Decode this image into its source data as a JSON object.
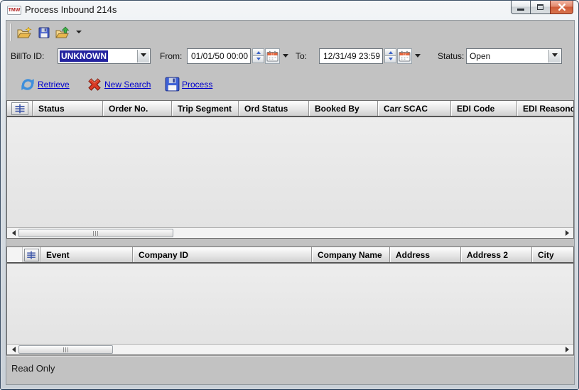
{
  "window": {
    "title": "Process Inbound 214s",
    "app_icon_text": "TMW",
    "status_text": "Read Only"
  },
  "toolbar": {
    "icons": [
      "new-folder-icon",
      "save-icon",
      "export-folder-icon",
      "toolbar-overflow-arrow"
    ]
  },
  "filters": {
    "billto_label": "BillTo ID:",
    "billto_value": "UNKNOWN",
    "from_label": "From:",
    "from_value": "01/01/50 00:00",
    "to_label": "To:",
    "to_value": "12/31/49 23:59",
    "status_label": "Status:",
    "status_value": "Open"
  },
  "actions": {
    "retrieve": "Retrieve",
    "new_search": "New Search",
    "process": "Process"
  },
  "upper_grid": {
    "columns": [
      "Status",
      "Order No.",
      "Trip Segment",
      "Ord Status",
      "Booked By",
      "Carr SCAC",
      "EDI Code",
      "EDI Reasoncode"
    ],
    "rows": []
  },
  "lower_grid": {
    "columns": [
      "Event",
      "Company ID",
      "Company Name",
      "Address",
      "Address 2",
      "City"
    ],
    "rows": []
  },
  "colors": {
    "selection_highlight": "#23239f",
    "link_blue": "#0000cc",
    "close_button_red": "#cf5a38",
    "client_background": "#c2c2c2",
    "grid_body": "#e9e9e9",
    "refresh_icon_blue": "#3f8fdb",
    "cancel_icon_red": "#d93a25",
    "save_icon_blue": "#3f62d6",
    "folder_icon_yellow": "#f5d78e"
  }
}
